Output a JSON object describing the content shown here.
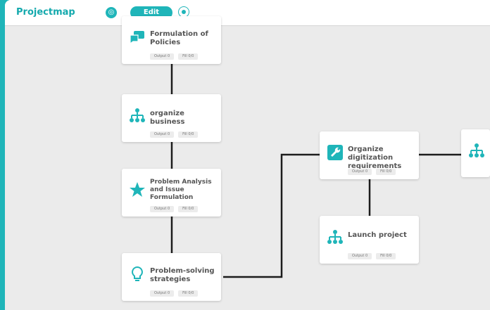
{
  "header": {
    "app_title": "Projectmap",
    "edit_label": "Edit"
  },
  "colors": {
    "accent": "#1fb5b9",
    "connector": "#1c1c1c",
    "canvas": "#ebebeb"
  },
  "cards": [
    {
      "id": "c1",
      "title": "Formulation of Policies",
      "icon": "speech-bubbles-icon",
      "output": "Output 0",
      "fill": "Fill 0/0"
    },
    {
      "id": "c2",
      "title": "organize business",
      "icon": "hierarchy-icon",
      "output": "Output 0",
      "fill": "Fill 0/0"
    },
    {
      "id": "c3",
      "title": "Problem Analysis and Issue Formulation",
      "icon": "star-icon",
      "output": "Output 0",
      "fill": "Fill 0/0"
    },
    {
      "id": "c4",
      "title": "Problem-solving strategies",
      "icon": "lightbulb-icon",
      "output": "Output 0",
      "fill": "Fill 0/0"
    },
    {
      "id": "c5",
      "title": "Organize digitization requirements",
      "icon": "wrench-icon",
      "output": "Output 0",
      "fill": "Fill 0/0"
    },
    {
      "id": "c6",
      "title": "Launch project",
      "icon": "hierarchy-icon",
      "output": "Output 0",
      "fill": "Fill 0/0"
    }
  ]
}
